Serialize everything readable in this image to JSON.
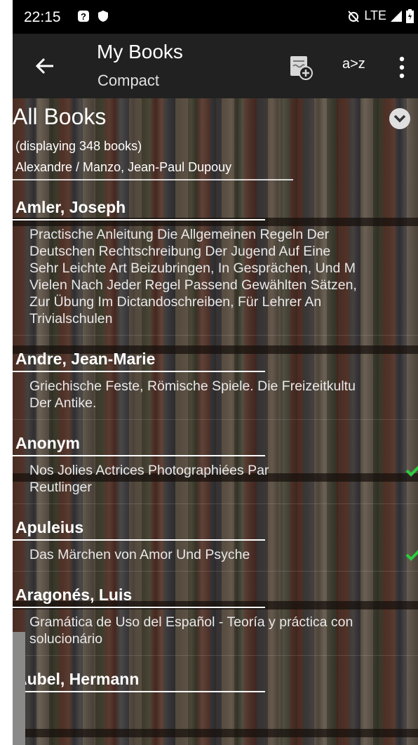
{
  "status_bar": {
    "time": "22:15",
    "network": "LTE"
  },
  "toolbar": {
    "title": "My Books",
    "subtitle": "Compact",
    "sort_label": "a>z"
  },
  "header": {
    "title": "All Books",
    "count_text": "(displaying 348 books)",
    "range_text": "Alexandre / Manzo, Jean-Paul Dupouy"
  },
  "groups": [
    {
      "author": "Amler, Joseph",
      "books": [
        {
          "title": "Practische Anleitung Die Allgemeinen Regeln Der\nDeutschen Rechtschreibung Der Jugend Auf Eine\nSehr Leichte Art Beizubringen, In Gesprächen, Und M\nVielen Nach Jeder Regel Passend Gewählten Sätzen,\nZur Übung Im Dictandoschreiben, Für Lehrer An\nTrivialschulen",
          "checked": false
        }
      ]
    },
    {
      "author": "Andre, Jean-Marie",
      "books": [
        {
          "title": "Griechische Feste, Römische Spiele. Die Freizeitkultu\nDer Antike.",
          "checked": false
        }
      ]
    },
    {
      "author": "Anonym",
      "books": [
        {
          "title": "Nos Jolies Actrices Photographiées Par\nReutlinger",
          "checked": true
        }
      ]
    },
    {
      "author": "Apuleius",
      "books": [
        {
          "title": "Das Märchen von Amor Und Psyche",
          "checked": true
        }
      ]
    },
    {
      "author": "Aragonés, Luis",
      "books": [
        {
          "title": "Gramática de Uso del Español - Teoría y práctica con\nsolucionário",
          "checked": false
        }
      ]
    },
    {
      "author": "Aubel, Hermann",
      "books": []
    }
  ],
  "colors": {
    "toolbar": "#212121",
    "status_bar": "#000000",
    "check": "#2ecc40"
  }
}
